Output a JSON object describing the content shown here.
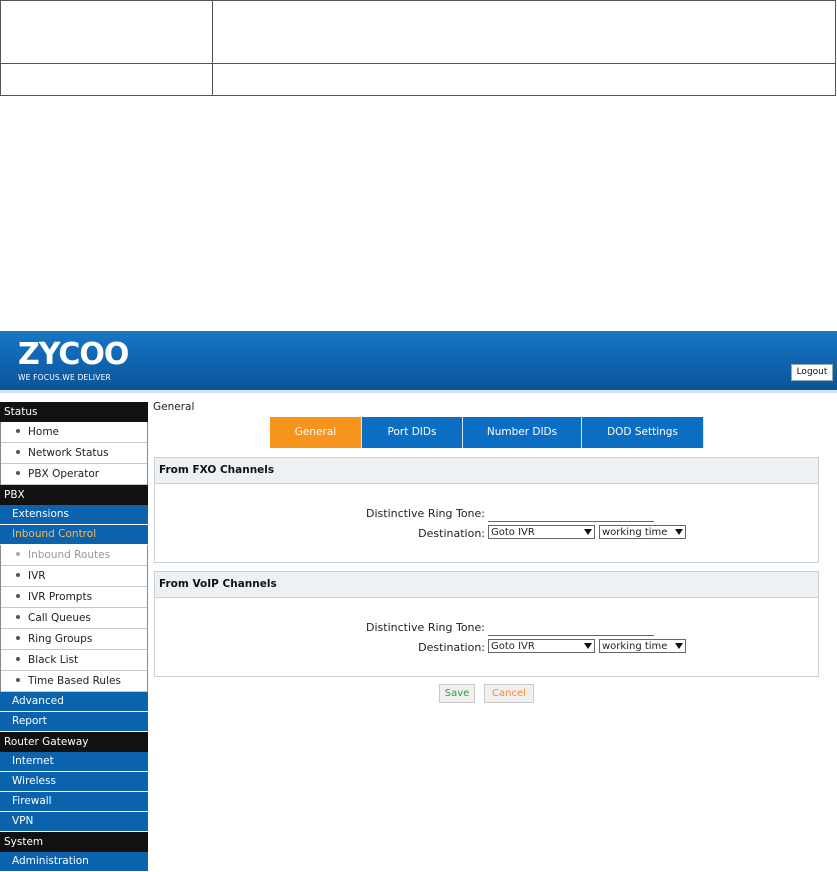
{
  "brand": {
    "logo": "ZYCOO",
    "tagline": "WE FOCUS.WE DELIVER",
    "logout_label": "Logout"
  },
  "sidebar": {
    "status_section": "Status",
    "status_items": [
      "Home",
      "Network Status",
      "PBX Operator"
    ],
    "pbx_section": "PBX",
    "extensions": "Extensions",
    "inbound_control": "Inbound Control",
    "inbound_items": [
      "Inbound Routes",
      "IVR",
      "IVR Prompts",
      "Call Queues",
      "Ring Groups",
      "Black List",
      "Time Based Rules"
    ],
    "advanced": "Advanced",
    "report": "Report",
    "router_section": "Router Gateway",
    "router_items": [
      "Internet",
      "Wireless",
      "Firewall",
      "VPN"
    ],
    "system_section": "System",
    "system_items": [
      "Administration"
    ]
  },
  "main": {
    "title": "General",
    "tabs": [
      "General",
      "Port DIDs",
      "Number DIDs",
      "DOD Settings"
    ],
    "active_tab": "General",
    "fxo": {
      "heading": "From FXO Channels",
      "ring_tone_label": "Distinctive Ring Tone:",
      "ring_tone_value": "",
      "destination_label": "Destination:",
      "destination_value": "Goto IVR",
      "ivr_value": "working time"
    },
    "voip": {
      "heading": "From VoIP Channels",
      "ring_tone_label": "Distinctive Ring Tone:",
      "ring_tone_value": "",
      "destination_label": "Destination:",
      "destination_value": "Goto IVR",
      "ivr_value": "working time"
    },
    "save_label": "Save",
    "cancel_label": "Cancel"
  },
  "colors": {
    "banner": "#0f63ad",
    "tab_active": "#f7941d",
    "tab": "#0b6ec2",
    "menu_open": "#ffb84a"
  }
}
